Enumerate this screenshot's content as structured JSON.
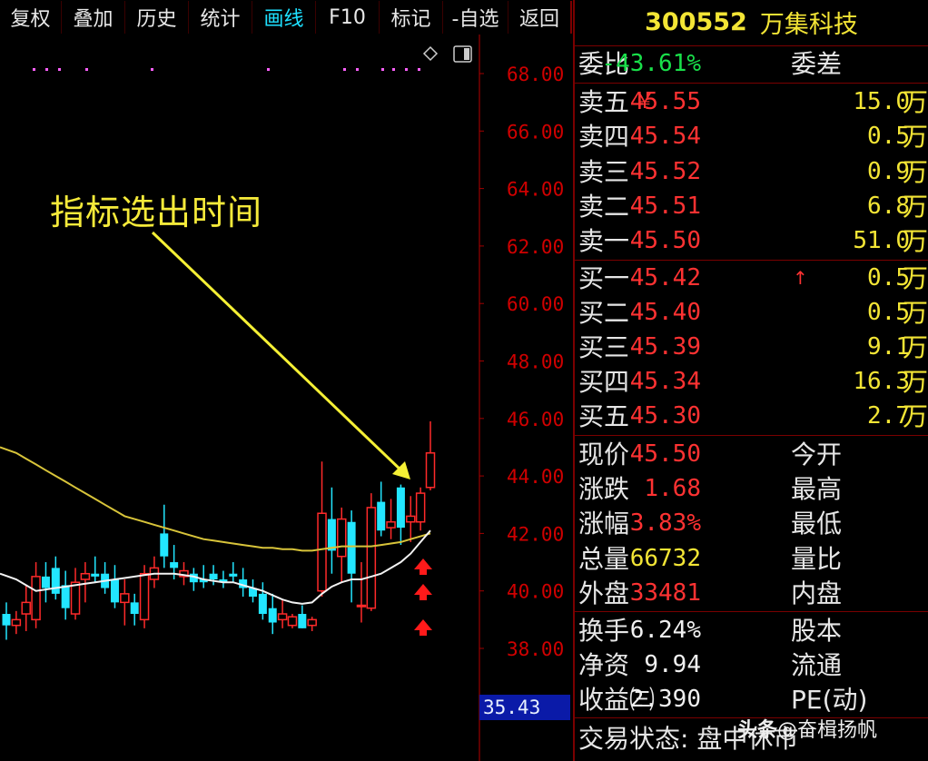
{
  "toolbar": {
    "items": [
      {
        "label": "复权"
      },
      {
        "label": "叠加"
      },
      {
        "label": "历史"
      },
      {
        "label": "统计"
      },
      {
        "label": "画线"
      },
      {
        "label": "F10"
      },
      {
        "label": "标记"
      },
      {
        "label": "-自选"
      },
      {
        "label": "返回"
      }
    ],
    "active_index": 4
  },
  "annotation": {
    "text": "指标选出时间"
  },
  "price_axis": {
    "ticks": [
      "68.00",
      "66.00",
      "64.00",
      "62.00",
      "60.00",
      "48.00",
      "46.00",
      "44.00",
      "42.00",
      "40.00",
      "38.00"
    ]
  },
  "current_price_marker": "35.43",
  "chart_data": {
    "type": "candlestick",
    "y_ticks": [
      68,
      66,
      64,
      62,
      60,
      48,
      46,
      44,
      42,
      40,
      38
    ],
    "candles": [
      {
        "o": 39.2,
        "h": 39.6,
        "l": 38.3,
        "c": 38.8
      },
      {
        "o": 38.8,
        "h": 39.3,
        "l": 38.5,
        "c": 39.0
      },
      {
        "o": 39.2,
        "h": 40.2,
        "l": 38.6,
        "c": 39.6
      },
      {
        "o": 39.0,
        "h": 41.0,
        "l": 38.7,
        "c": 40.5
      },
      {
        "o": 40.5,
        "h": 41.0,
        "l": 39.6,
        "c": 40.1
      },
      {
        "o": 40.8,
        "h": 41.2,
        "l": 39.7,
        "c": 39.9
      },
      {
        "o": 40.2,
        "h": 40.7,
        "l": 39.0,
        "c": 39.4
      },
      {
        "o": 39.2,
        "h": 40.8,
        "l": 39.0,
        "c": 40.3
      },
      {
        "o": 40.4,
        "h": 41.0,
        "l": 39.6,
        "c": 40.6
      },
      {
        "o": 40.6,
        "h": 41.2,
        "l": 40.3,
        "c": 40.5
      },
      {
        "o": 40.6,
        "h": 41.0,
        "l": 39.9,
        "c": 40.1
      },
      {
        "o": 40.4,
        "h": 40.9,
        "l": 39.4,
        "c": 39.6
      },
      {
        "o": 39.6,
        "h": 40.4,
        "l": 38.8,
        "c": 39.9
      },
      {
        "o": 39.6,
        "h": 39.9,
        "l": 38.8,
        "c": 39.2
      },
      {
        "o": 39.0,
        "h": 40.9,
        "l": 38.7,
        "c": 40.6
      },
      {
        "o": 40.4,
        "h": 41.2,
        "l": 40.1,
        "c": 40.8
      },
      {
        "o": 42.0,
        "h": 43.0,
        "l": 40.8,
        "c": 41.2
      },
      {
        "o": 41.0,
        "h": 41.6,
        "l": 40.4,
        "c": 40.8
      },
      {
        "o": 40.5,
        "h": 41.0,
        "l": 40.2,
        "c": 40.7
      },
      {
        "o": 40.6,
        "h": 40.8,
        "l": 40.0,
        "c": 40.3
      },
      {
        "o": 40.4,
        "h": 40.9,
        "l": 40.1,
        "c": 40.3
      },
      {
        "o": 40.6,
        "h": 40.9,
        "l": 40.2,
        "c": 40.4
      },
      {
        "o": 40.4,
        "h": 40.7,
        "l": 40.1,
        "c": 40.3
      },
      {
        "o": 40.6,
        "h": 41.0,
        "l": 40.3,
        "c": 40.5
      },
      {
        "o": 40.4,
        "h": 40.8,
        "l": 39.8,
        "c": 40.1
      },
      {
        "o": 40.1,
        "h": 40.4,
        "l": 39.6,
        "c": 39.8
      },
      {
        "o": 39.9,
        "h": 40.3,
        "l": 39.0,
        "c": 39.2
      },
      {
        "o": 39.4,
        "h": 39.9,
        "l": 38.5,
        "c": 38.9
      },
      {
        "o": 39.0,
        "h": 39.7,
        "l": 38.7,
        "c": 39.2
      },
      {
        "o": 38.8,
        "h": 39.2,
        "l": 38.7,
        "c": 39.1
      },
      {
        "o": 39.2,
        "h": 39.5,
        "l": 38.7,
        "c": 38.7
      },
      {
        "o": 38.8,
        "h": 39.1,
        "l": 38.6,
        "c": 39.0
      },
      {
        "o": 40.0,
        "h": 44.5,
        "l": 39.8,
        "c": 42.7
      },
      {
        "o": 42.5,
        "h": 43.6,
        "l": 40.6,
        "c": 41.4
      },
      {
        "o": 41.2,
        "h": 42.9,
        "l": 40.3,
        "c": 42.5
      },
      {
        "o": 42.4,
        "h": 42.8,
        "l": 39.6,
        "c": 40.6
      },
      {
        "o": 39.5,
        "h": 41.0,
        "l": 38.9,
        "c": 39.5
      },
      {
        "o": 39.4,
        "h": 43.4,
        "l": 39.3,
        "c": 42.9
      },
      {
        "o": 43.1,
        "h": 43.8,
        "l": 41.9,
        "c": 42.1
      },
      {
        "o": 42.2,
        "h": 43.2,
        "l": 41.8,
        "c": 42.4
      },
      {
        "o": 43.6,
        "h": 43.7,
        "l": 41.6,
        "c": 42.2
      },
      {
        "o": 42.4,
        "h": 43.3,
        "l": 41.7,
        "c": 42.6
      },
      {
        "o": 42.4,
        "h": 43.6,
        "l": 42.1,
        "c": 43.4
      },
      {
        "o": 43.6,
        "h": 45.9,
        "l": 43.5,
        "c": 44.8
      }
    ],
    "ma_yellow": [
      45.0,
      44.8,
      44.6,
      44.4,
      44.2,
      44.0,
      43.8,
      43.6,
      43.4,
      43.2,
      43.0,
      42.8,
      42.6,
      42.5,
      42.4,
      42.3,
      42.2,
      42.1,
      42.0,
      41.9,
      41.8,
      41.75,
      41.7,
      41.65,
      41.6,
      41.55,
      41.5,
      41.5,
      41.45,
      41.45,
      41.4,
      41.4,
      41.45,
      41.5,
      41.55,
      41.55,
      41.55,
      41.55,
      41.6,
      41.65,
      41.7,
      41.8,
      41.9,
      42.0
    ],
    "ma_white": [
      40.6,
      40.4,
      40.2,
      40.0,
      40.05,
      40.1,
      40.15,
      40.2,
      40.25,
      40.3,
      40.35,
      40.4,
      40.45,
      40.5,
      40.55,
      40.6,
      40.6,
      40.6,
      40.55,
      40.5,
      40.4,
      40.35,
      40.3,
      40.3,
      40.2,
      40.1,
      40.0,
      39.85,
      39.7,
      39.6,
      39.55,
      39.6,
      39.9,
      40.15,
      40.3,
      40.4,
      40.4,
      40.5,
      40.6,
      40.8,
      41.0,
      41.3,
      41.7,
      42.1
    ],
    "signal_arrows_at_candles": [
      43,
      43,
      43
    ]
  },
  "stock": {
    "code": "300552",
    "name": "万集科技"
  },
  "order_ratio": {
    "label": "委比",
    "value": "-43.61%",
    "label2": "委差"
  },
  "sells": [
    {
      "label": "卖五",
      "price": "45.55",
      "vol": "15.0",
      "unit": "万",
      "mark": "￥"
    },
    {
      "label": "卖四",
      "price": "45.54",
      "vol": "0.5",
      "unit": "万"
    },
    {
      "label": "卖三",
      "price": "45.52",
      "vol": "0.9",
      "unit": "万"
    },
    {
      "label": "卖二",
      "price": "45.51",
      "vol": "6.8",
      "unit": "万"
    },
    {
      "label": "卖一",
      "price": "45.50",
      "vol": "51.0",
      "unit": "万"
    }
  ],
  "buys": [
    {
      "label": "买一",
      "price": "45.42",
      "vol": "0.5",
      "unit": "万",
      "mark": "↑"
    },
    {
      "label": "买二",
      "price": "45.40",
      "vol": "0.5",
      "unit": "万"
    },
    {
      "label": "买三",
      "price": "45.39",
      "vol": "9.1",
      "unit": "万"
    },
    {
      "label": "买四",
      "price": "45.34",
      "vol": "16.3",
      "unit": "万"
    },
    {
      "label": "买五",
      "price": "45.30",
      "vol": "2.7",
      "unit": "万"
    }
  ],
  "stats": [
    {
      "label": "现价",
      "value": "45.50",
      "color": "#ff3232",
      "label2": "今开"
    },
    {
      "label": "涨跌",
      "value": "1.68",
      "color": "#ff3232",
      "label2": "最高"
    },
    {
      "label": "涨幅",
      "value": "3.83%",
      "color": "#ff3232",
      "label2": "最低"
    },
    {
      "label": "总量",
      "value": "66732",
      "color": "#f3e535",
      "label2": "量比"
    },
    {
      "label": "外盘",
      "value": "33481",
      "color": "#ff3232",
      "label2": "内盘"
    }
  ],
  "stats2": [
    {
      "label": "换手",
      "value": "6.24%",
      "color": "#f0f0f0",
      "label2": "股本"
    },
    {
      "label": "净资",
      "value": "9.94",
      "color": "#f0f0f0",
      "label2": "流通"
    },
    {
      "label": "收益㈢",
      "value": "2.390",
      "color": "#f0f0f0",
      "label2": "PE(动)"
    }
  ],
  "trade_status": {
    "text": "交易状态: 盘中休市"
  },
  "watermark": {
    "prefix": "头条",
    "text": "@奋楫扬帆"
  }
}
